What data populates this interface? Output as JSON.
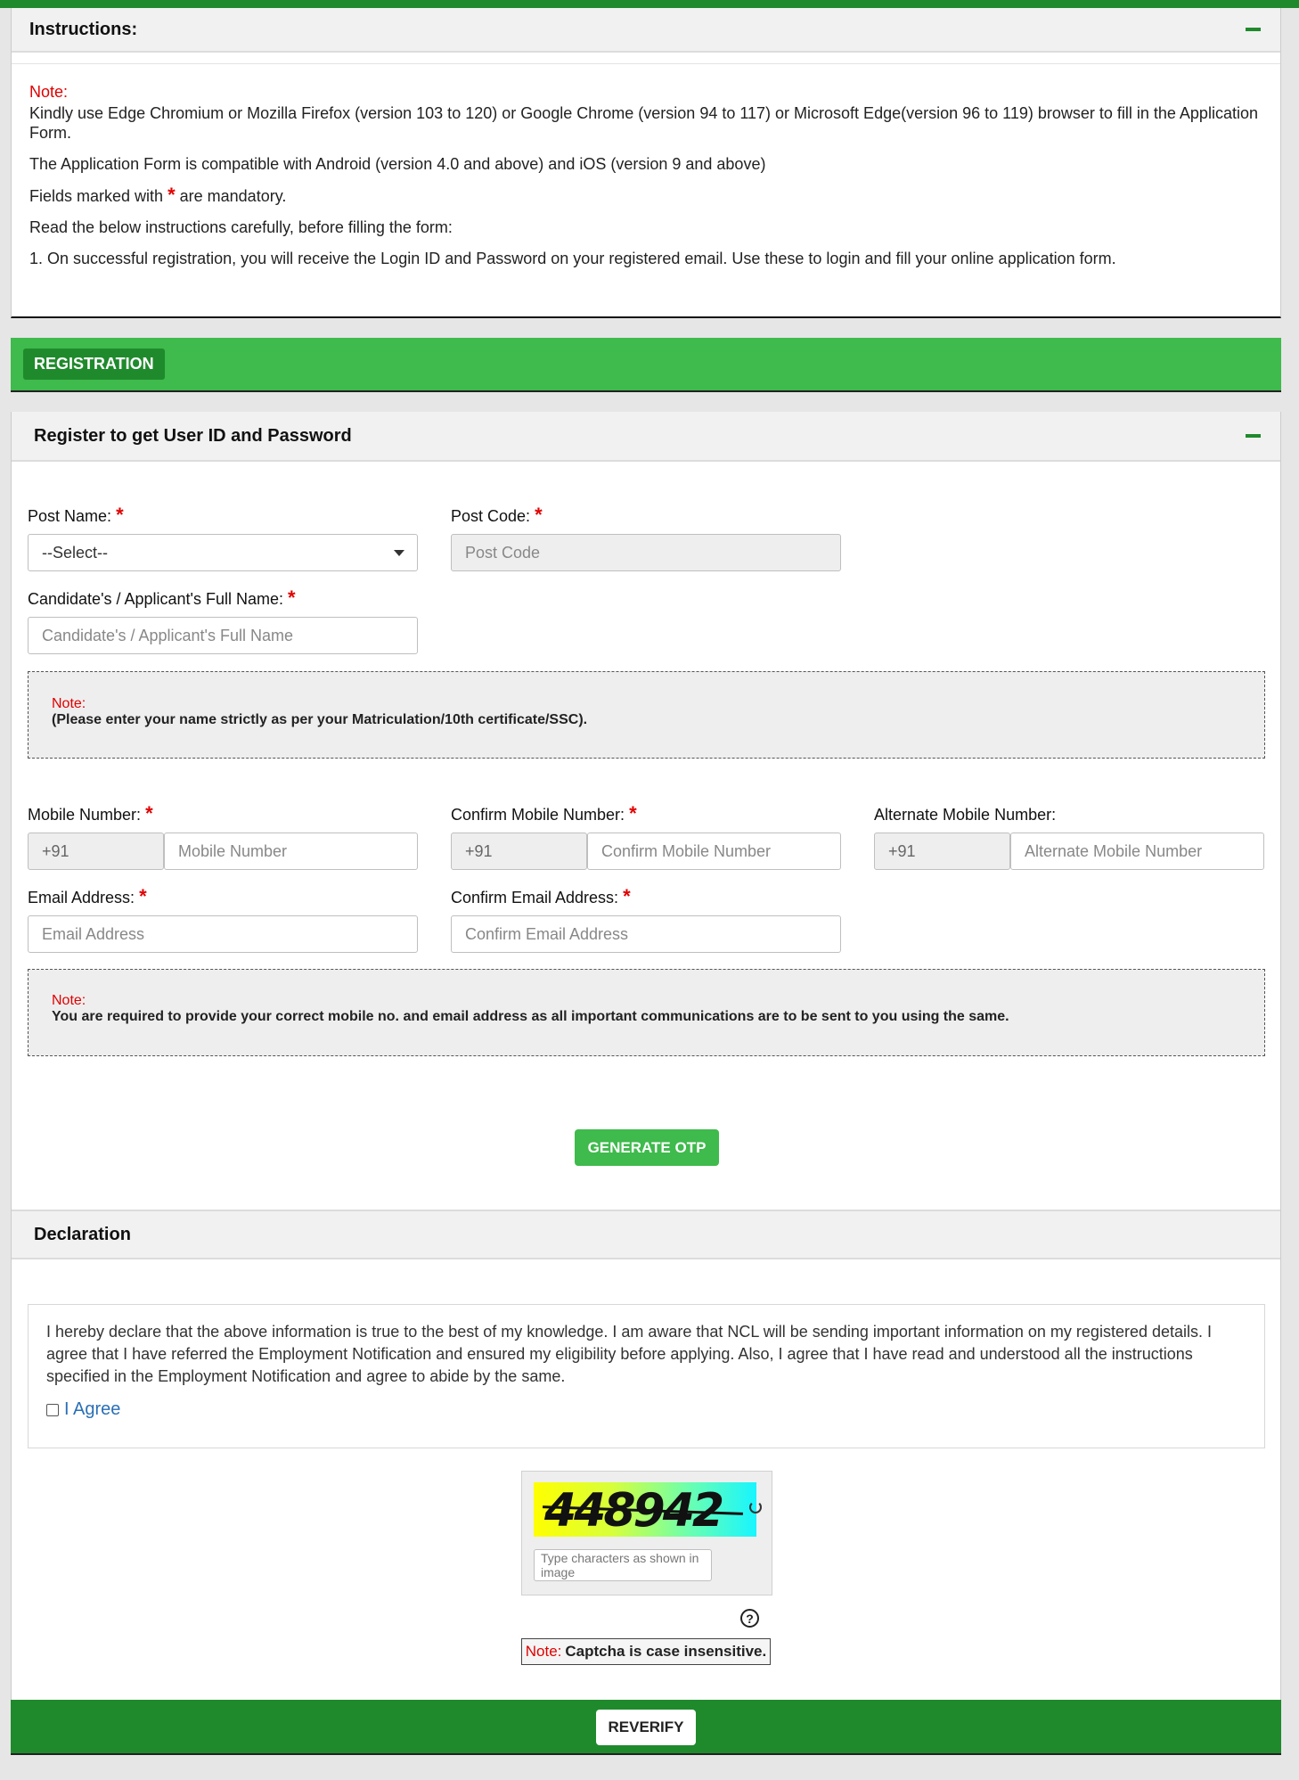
{
  "instructions": {
    "title": "Instructions:",
    "note_label": "Note:",
    "line1": "Kindly use Edge Chromium or Mozilla Firefox (version 103 to 120) or Google Chrome (version 94 to 117) or Microsoft Edge(version 96 to 119) browser to fill in the Application Form.",
    "line2": "The Application Form is compatible with Android (version 4.0 and above) and iOS (version 9 and above)",
    "line3_pre": "Fields marked with",
    "line3_star": "*",
    "line3_post": "are mandatory.",
    "line4": "Read the below instructions carefully, before filling the form:",
    "item1": "1. On successful registration, you will receive the Login ID and Password on your registered email. Use these to login and fill your online application form."
  },
  "registration": {
    "label": "REGISTRATION"
  },
  "register": {
    "title": "Register to get User ID and Password",
    "post_name": {
      "label": "Post Name:",
      "value": "--Select--"
    },
    "post_code": {
      "label": "Post Code:",
      "placeholder": "Post Code"
    },
    "full_name": {
      "label": "Candidate's / Applicant's Full Name:",
      "placeholder": "Candidate's / Applicant's Full Name"
    },
    "name_note": {
      "title": "Note:",
      "text": "(Please enter your name strictly as per your Matriculation/10th certificate/SSC)."
    },
    "mobile": {
      "label": "Mobile Number:",
      "prefix": "+91",
      "placeholder": "Mobile Number"
    },
    "confirm_mobile": {
      "label": "Confirm Mobile Number:",
      "prefix": "+91",
      "placeholder": "Confirm Mobile Number"
    },
    "alt_mobile": {
      "label": "Alternate Mobile Number:",
      "prefix": "+91",
      "placeholder": "Alternate Mobile Number"
    },
    "email": {
      "label": "Email Address:",
      "placeholder": "Email Address"
    },
    "confirm_email": {
      "label": "Confirm Email Address:",
      "placeholder": "Confirm Email Address"
    },
    "contact_note": {
      "title": "Note:",
      "text": "You are required to provide your correct mobile no. and email address as all important communications are to be sent to you using the same."
    },
    "generate_otp": "GENERATE OTP",
    "required_star": "*"
  },
  "declaration": {
    "title": "Declaration",
    "text": "I hereby declare that the above information is true to the best of my knowledge. I am aware that NCL will be sending important information on my registered details. I agree that I have referred the Employment Notification and ensured my eligibility before applying. Also, I agree that I have read and understood all the instructions specified in the Employment Notification and agree to abide by the same.",
    "agree_label": "I Agree"
  },
  "captcha": {
    "image_text": "448942",
    "input_placeholder": "Type characters as shown in image",
    "help_glyph": "?",
    "note_label": "Note:",
    "note_text": "Captcha is case insensitive."
  },
  "footer": {
    "reverify": "REVERIFY"
  },
  "colors": {
    "primary_green": "#3fba4c",
    "dark_green": "#1f8a2c",
    "required_red": "#e00000",
    "link_blue": "#2a6fb5"
  }
}
